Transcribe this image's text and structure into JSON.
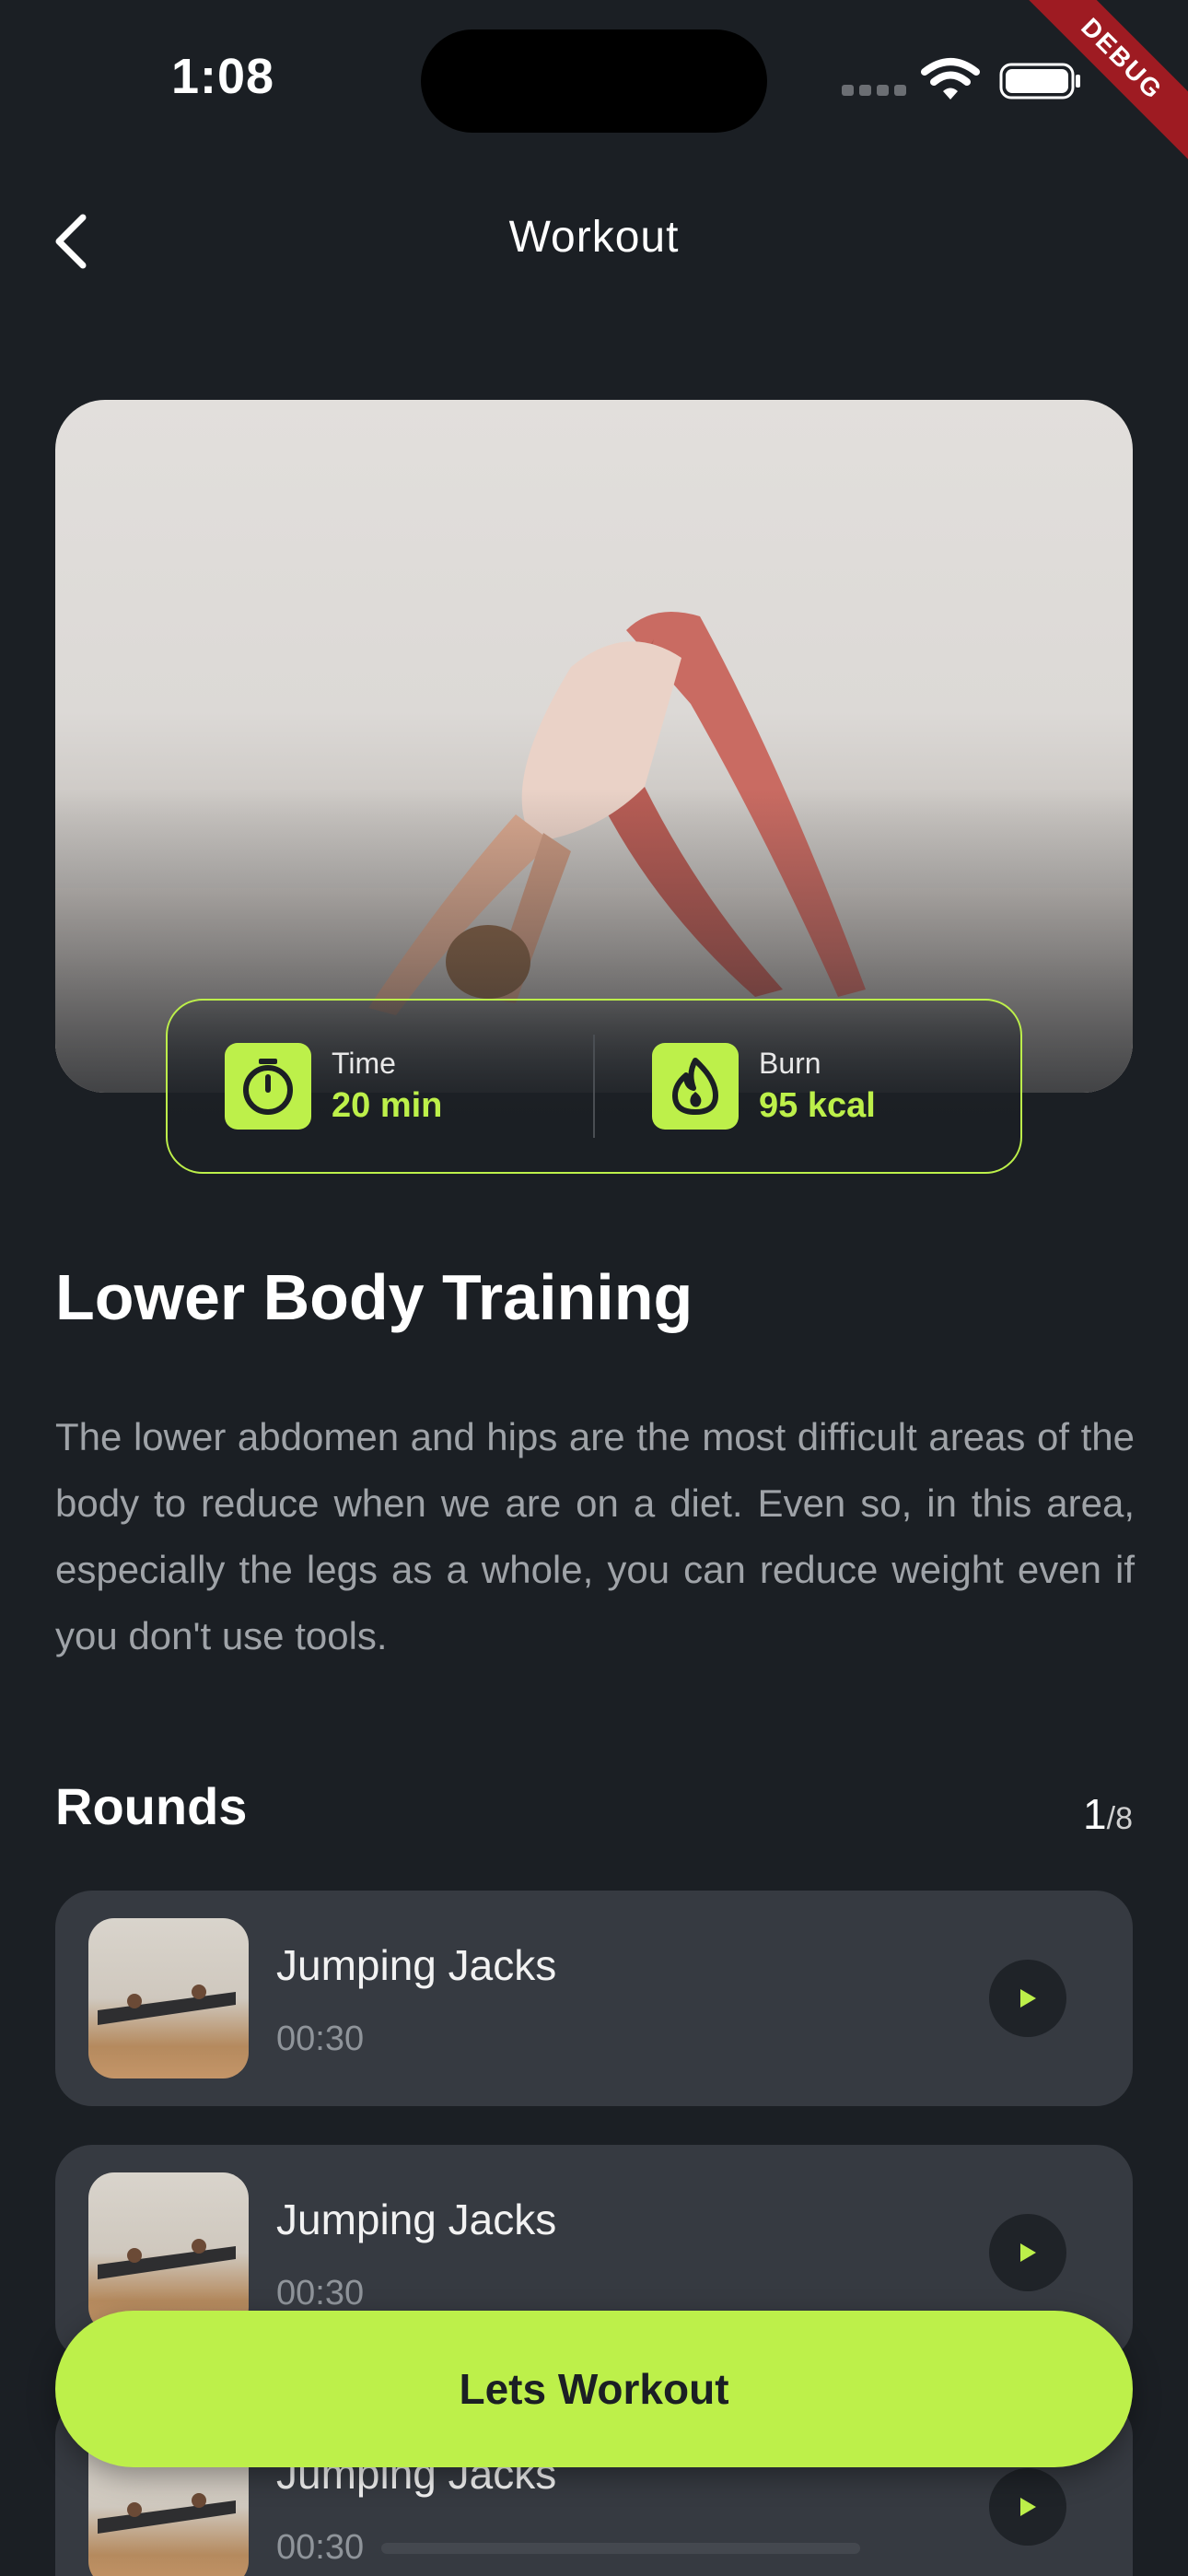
{
  "status_bar": {
    "time": "1:08",
    "debug_label": "DEBUG"
  },
  "nav": {
    "title": "Workout"
  },
  "stats": {
    "time": {
      "label": "Time",
      "value": "20 min",
      "icon": "timer-icon"
    },
    "burn": {
      "label": "Burn",
      "value": "95 kcal",
      "icon": "flame-icon"
    }
  },
  "workout": {
    "title": "Lower Body Training",
    "description": "The lower abdomen and hips are the most difficult areas of the body to reduce when we are on a diet. Even so, in this area, especially the legs as a whole, you can reduce weight even if you don't use tools."
  },
  "rounds": {
    "title": "Rounds",
    "current": "1",
    "total": "/8",
    "items": [
      {
        "name": "Jumping Jacks",
        "duration": "00:30"
      },
      {
        "name": "Jumping Jacks",
        "duration": "00:30"
      },
      {
        "name": "Jumping Jacks",
        "duration": "00:30"
      }
    ]
  },
  "cta": {
    "label": "Lets Workout"
  },
  "colors": {
    "accent": "#bdf04a",
    "background": "#1b1f24",
    "card": "#363a41",
    "debug": "#9e1b22"
  }
}
